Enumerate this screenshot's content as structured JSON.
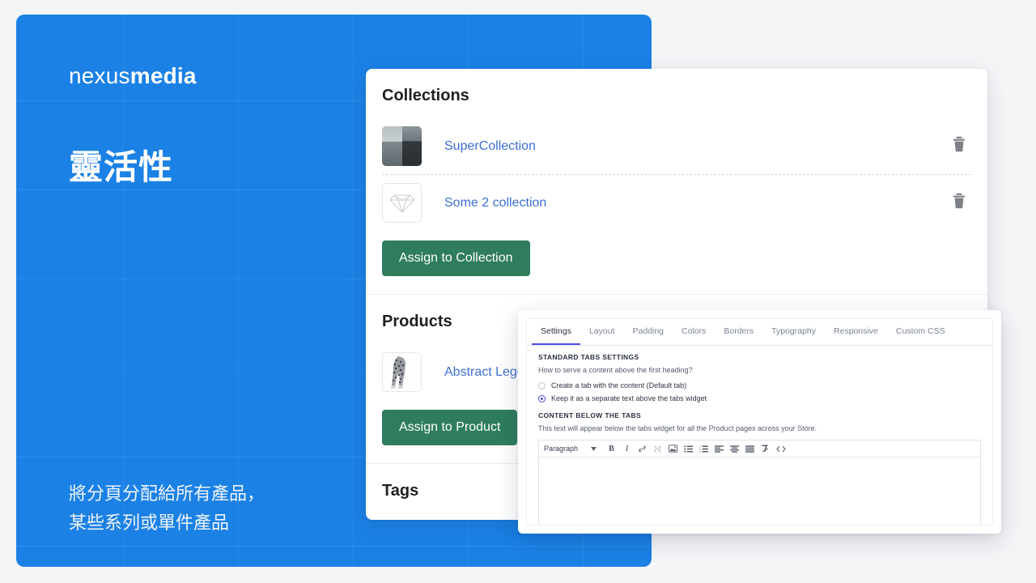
{
  "hero": {
    "logo_light": "nexus",
    "logo_bold": "media",
    "title": "靈活性",
    "subtitle_line1": "將分頁分配給所有產品，",
    "subtitle_line2": "某些系列或單件產品",
    "brand_color": "#1b81e5"
  },
  "card": {
    "collections": {
      "heading": "Collections",
      "rows": [
        {
          "label": "SuperCollection",
          "thumb": "seascape-thumbnail",
          "delete_icon": "trash-icon"
        },
        {
          "label": "Some 2 collection",
          "thumb": "diamond-thumbnail",
          "delete_icon": "trash-icon"
        }
      ],
      "assign_button": "Assign to Collection"
    },
    "products": {
      "heading": "Products",
      "rows": [
        {
          "label": "Abstract Leggings",
          "thumb": "leggings-thumbnail"
        }
      ],
      "assign_button": "Assign to Product"
    },
    "tags": {
      "heading": "Tags"
    },
    "link_color": "#3d6fd0",
    "button_color": "#2f7d5d"
  },
  "settings_panel": {
    "tabs": [
      {
        "label": "Settings",
        "active": true
      },
      {
        "label": "Layout",
        "active": false
      },
      {
        "label": "Padding",
        "active": false
      },
      {
        "label": "Colors",
        "active": false
      },
      {
        "label": "Borders",
        "active": false
      },
      {
        "label": "Typography",
        "active": false
      },
      {
        "label": "Responsive",
        "active": false
      },
      {
        "label": "Custom CSS",
        "active": false
      }
    ],
    "active_tab_color": "#4a4ee0",
    "standard_tabs": {
      "group_title": "STANDARD TABS SETTINGS",
      "question": "How to serve a content above the first heading?",
      "options": [
        {
          "label": "Create a tab with the content (Default tab)",
          "selected": false
        },
        {
          "label": "Keep it as a separate text above the tabs widget",
          "selected": true
        }
      ]
    },
    "content_below": {
      "group_title": "CONTENT BELOW THE TABS",
      "description": "This text will appear below the tabs widget for all the Product pages across your Store."
    },
    "editor": {
      "format_value": "Paragraph",
      "toolbar": [
        "bold-icon",
        "italic-icon",
        "link-icon",
        "unlink-icon",
        "image-icon",
        "bullet-list-icon",
        "numbered-list-icon",
        "align-left-icon",
        "align-center-icon",
        "align-justify-icon",
        "clear-format-icon",
        "code-icon"
      ],
      "content": ""
    }
  }
}
